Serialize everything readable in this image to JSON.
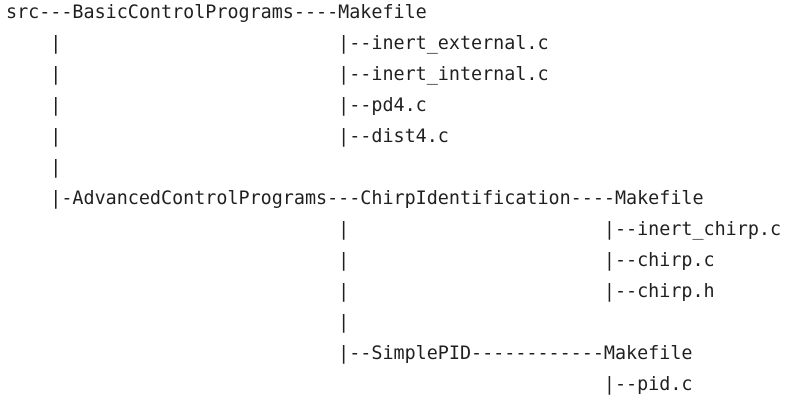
{
  "file_tree": {
    "lines": [
      "src---BasicControlPrograms----Makefile",
      "    |                         |--inert_external.c",
      "    |                         |--inert_internal.c",
      "    |                         |--pd4.c",
      "    |                         |--dist4.c",
      "    |",
      "    |-AdvancedControlPrograms---ChirpIdentification----Makefile",
      "                              |                       |--inert_chirp.c",
      "                              |                       |--chirp.c",
      "                              |                       |--chirp.h",
      "                              |",
      "                              |--SimplePID------------Makefile",
      "                                                      |--pid.c"
    ]
  }
}
